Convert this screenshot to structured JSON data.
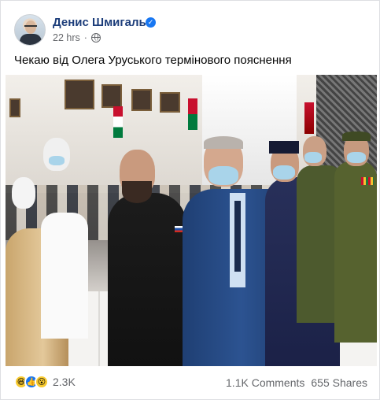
{
  "post": {
    "author": "Денис Шмигаль",
    "verified": true,
    "timestamp": "22 hrs",
    "audience_icon": "globe-icon",
    "text": "Чекаю від Олега Уруського термінового пояснення"
  },
  "photo": {
    "description_icon": "photo-image"
  },
  "footer": {
    "reactions": [
      "haha",
      "like",
      "wow"
    ],
    "reaction_count": "2.3K",
    "comments": "1.1K Comments",
    "shares": "655 Shares"
  },
  "colors": {
    "author_name": "#1c3d7a",
    "verified_badge": "#1877f2",
    "meta_text": "#65676b"
  }
}
